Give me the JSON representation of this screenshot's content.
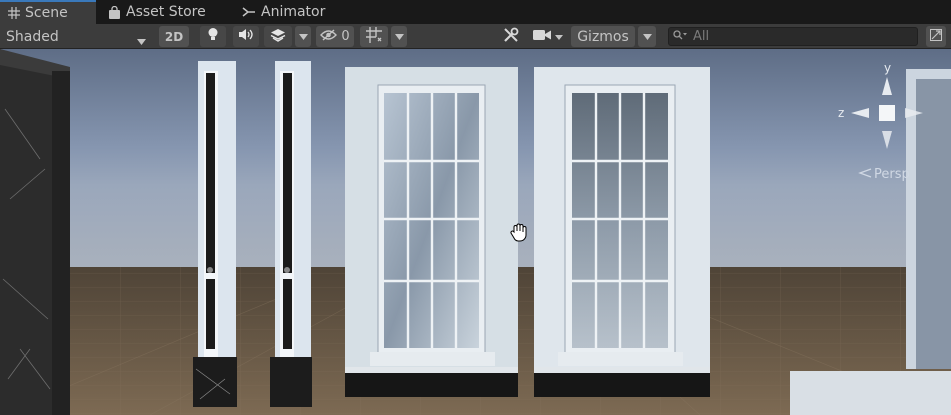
{
  "tabs": [
    {
      "label": "Scene",
      "icon": "grid-icon",
      "active": true
    },
    {
      "label": "Asset Store",
      "icon": "shopping-bag-icon",
      "active": false
    },
    {
      "label": "Animator",
      "icon": "animator-icon",
      "active": false
    }
  ],
  "toolbar": {
    "draw_mode": "Shaded",
    "mode_2d": "2D",
    "hidden_count": "0",
    "gizmos": "Gizmos",
    "search_placeholder": "All"
  },
  "scene": {
    "projection_label": "Persp",
    "gizmo_axes": {
      "y": "y",
      "z": "z"
    }
  },
  "colors": {
    "accent": "#3a79bb",
    "toolbar_bg": "#3c3c3c",
    "tab_bg": "#191919",
    "sky_top": "#5f6f88",
    "ground": "#6e5a44"
  }
}
